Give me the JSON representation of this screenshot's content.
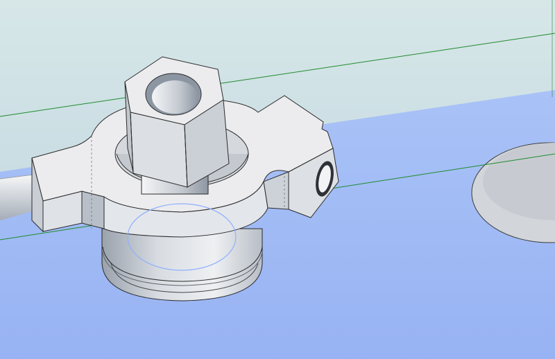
{
  "viewport": {
    "colors": {
      "background_upper": "#d0e2e6",
      "background_lower": "#9db8f4",
      "construction_line": "#1d8a2a",
      "part_face_light": "#ececee",
      "part_face_mid": "#d6d9de",
      "part_face_dark": "#b6bcc6",
      "edge": "#2a2a2a",
      "selection_highlight": "#8fb0ff"
    }
  }
}
